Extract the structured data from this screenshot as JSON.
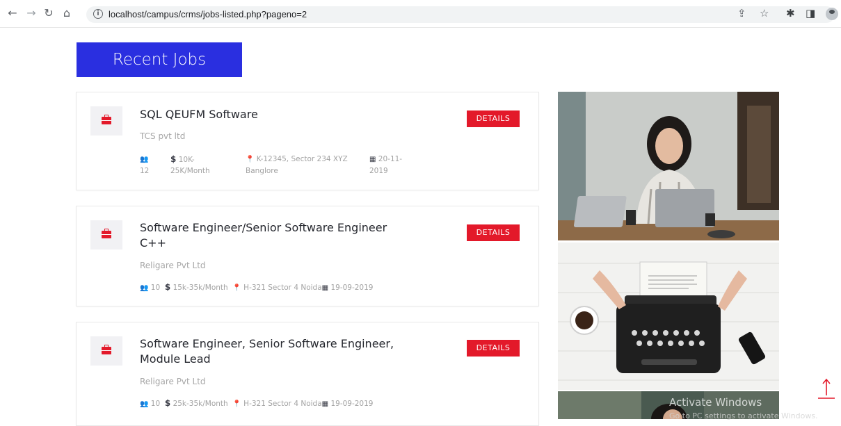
{
  "browser": {
    "url": "localhost/campus/crms/jobs-listed.php?pageno=2"
  },
  "page": {
    "heading": "Recent Jobs"
  },
  "jobs": [
    {
      "title": "SQL QEUFM Software",
      "company": "TCS pvt ltd",
      "vacancies": "12",
      "salary": "10K-25K/Month",
      "location": "K-12345, Sector 234 XYZ Banglore",
      "date": "20-11-2019",
      "details_label": "DETAILS"
    },
    {
      "title": "Software Engineer/Senior Software Engineer C++",
      "company": "Religare Pvt Ltd",
      "vacancies": "10",
      "salary": "15k-35k/Month",
      "location": "H-321 Sector 4 Noida",
      "date": "19-09-2019",
      "details_label": "DETAILS"
    },
    {
      "title": "Software Engineer, Senior Software Engineer, Module Lead",
      "company": "Religare Pvt Ltd",
      "vacancies": "10",
      "salary": "25k-35k/Month",
      "location": "H-321 Sector 4 Noida",
      "date": "19-09-2019",
      "details_label": "DETAILS"
    }
  ],
  "icons": {
    "job": "briefcase-icon",
    "vacancies": "users-icon",
    "salary": "dollar-icon",
    "location": "map-marker-icon",
    "date": "calendar-icon",
    "scroll_top": "arrow-up-icon"
  },
  "colors": {
    "heading_bg": "#2a2fe0",
    "accent": "#e3192a",
    "title_text": "#25272e",
    "muted_text": "#a6a6a6"
  },
  "watermark": {
    "line1": "Activate Windows",
    "line2": "Go to PC settings to activate Windows."
  }
}
